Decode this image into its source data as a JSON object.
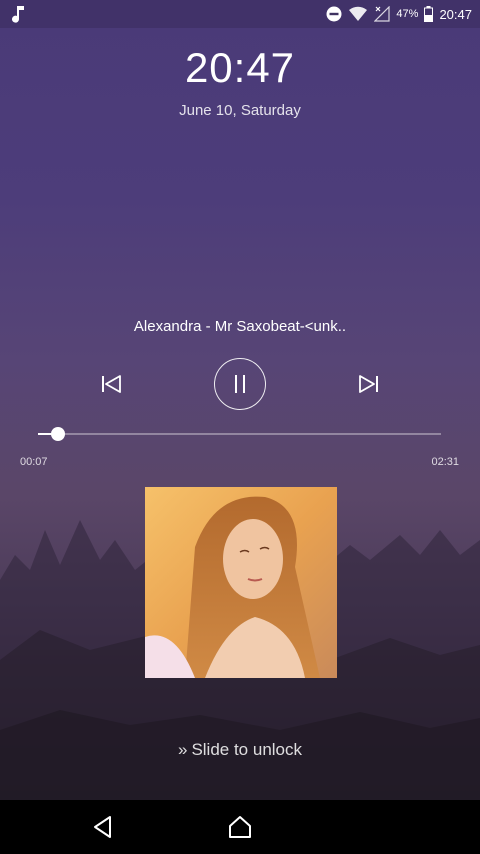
{
  "status_bar": {
    "left_icon": "music-note-icon",
    "icons": [
      "do-not-disturb-icon",
      "wifi-icon",
      "no-signal-icon",
      "battery-icon"
    ],
    "battery_percent": "47%",
    "time": "20:47"
  },
  "lockscreen": {
    "clock": "20:47",
    "date": "June 10, Saturday"
  },
  "player": {
    "title": "Alexandra  - Mr Saxobeat-<unk..",
    "elapsed": "00:07",
    "total": "02:31",
    "progress": 0.05,
    "controls": [
      "previous-icon",
      "pause-icon",
      "next-icon"
    ]
  },
  "unlock": {
    "icon": "double-chevron-right-icon",
    "label": "Slide to unlock"
  },
  "navbar": {
    "icons": [
      "back-icon",
      "home-icon"
    ]
  },
  "colors": {
    "accent": "#ffffff",
    "background_top": "#4a3a78",
    "background_bottom": "#2e2636"
  }
}
